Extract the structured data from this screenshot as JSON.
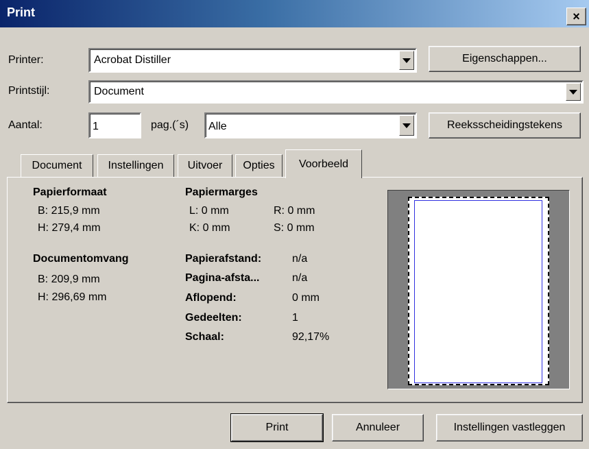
{
  "window": {
    "title": "Print",
    "close": "×"
  },
  "printer": {
    "label": "Printer:",
    "value": "Acrobat Distiller",
    "properties_button": "Eigenschappen..."
  },
  "style": {
    "label": "Printstijl:",
    "value": "Document"
  },
  "copies": {
    "label": "Aantal:",
    "value": "1",
    "pages_label": "pag.(´s)",
    "pages_value": "Alle",
    "separator_button": "Reeksscheidingstekens"
  },
  "tabs": [
    {
      "label": "Document"
    },
    {
      "label": "Instellingen"
    },
    {
      "label": "Uitvoer"
    },
    {
      "label": "Opties"
    },
    {
      "label": "Voorbeeld",
      "active": true
    }
  ],
  "preview": {
    "paper_format": {
      "heading": "Papierformaat",
      "width": "B:  215,9 mm",
      "height": "H:  279,4 mm"
    },
    "margins": {
      "heading": "Papiermarges",
      "left": "L: 0 mm",
      "right": "R: 0 mm",
      "top": "K: 0 mm",
      "bottom": "S: 0 mm"
    },
    "document_size": {
      "heading": "Documentomvang",
      "width": "B:  209,9 mm",
      "height": "H:  296,69 mm"
    },
    "details": [
      {
        "label": "Papierafstand:",
        "value": "n/a"
      },
      {
        "label": "Pagina-afsta...",
        "value": "n/a"
      },
      {
        "label": "Aflopend:",
        "value": "0 mm"
      },
      {
        "label": "Gedeelten:",
        "value": "1"
      },
      {
        "label": "Schaal:",
        "value": "92,17%"
      }
    ]
  },
  "buttons": {
    "print": "Print",
    "cancel": "Annuleer",
    "save_settings": "Instellingen vastleggen"
  }
}
